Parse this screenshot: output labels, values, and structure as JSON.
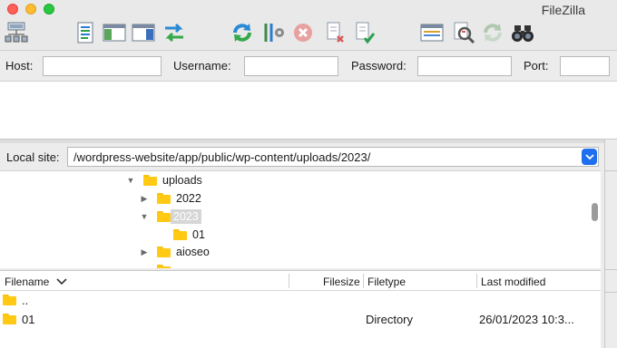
{
  "app": {
    "title": "FileZilla"
  },
  "quickconnect": {
    "host_label": "Host:",
    "username_label": "Username:",
    "password_label": "Password:",
    "port_label": "Port:",
    "host_value": "",
    "username_value": "",
    "password_value": "",
    "port_value": ""
  },
  "local": {
    "label": "Local site:",
    "path": "/wordpress-website/app/public/wp-content/uploads/2023/"
  },
  "tree": {
    "items": [
      {
        "label": "uploads",
        "expanded": true
      },
      {
        "label": "2022",
        "expanded": false
      },
      {
        "label": "2023",
        "expanded": true,
        "selected": true
      },
      {
        "label": "01"
      },
      {
        "label": "aioseo",
        "expanded": false
      }
    ]
  },
  "filelist": {
    "headers": {
      "filename": "Filename",
      "filesize": "Filesize",
      "filetype": "Filetype",
      "modified": "Last modified"
    },
    "rows": [
      {
        "name": "..",
        "size": "",
        "type": "",
        "modified": ""
      },
      {
        "name": "01",
        "size": "",
        "type": "Directory",
        "modified": "26/01/2023 10:3..."
      }
    ]
  },
  "colors": {
    "folder": "#ffc914",
    "accent": "#1e6ff0",
    "close": "#fe5f57",
    "minimize": "#febc2e",
    "zoom": "#28c840"
  },
  "toolbar_icons": [
    "site-manager-icon",
    "toggle-message-log-icon",
    "toggle-local-tree-icon",
    "toggle-remote-tree-icon",
    "toggle-transfer-queue-icon",
    "refresh-icon",
    "process-queue-icon",
    "cancel-icon",
    "disconnect-icon",
    "reconnect-icon",
    "directory-listing-filter-icon",
    "toggle-comparison-icon",
    "synchronized-browsing-icon",
    "search-remote-files-icon"
  ]
}
